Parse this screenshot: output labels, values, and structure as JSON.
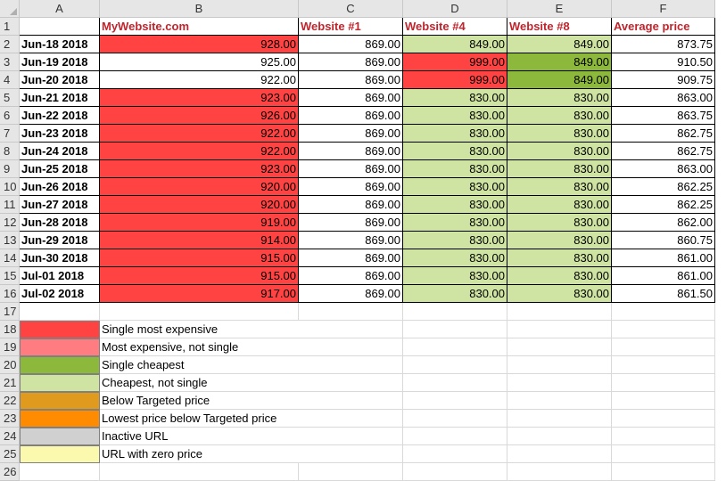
{
  "columns": [
    "A",
    "B",
    "C",
    "D",
    "E",
    "F"
  ],
  "header": [
    "",
    "MyWebsite.com",
    "Website #1",
    "Website #4",
    "Website #8",
    "Average price"
  ],
  "rows": [
    {
      "date": "Jun-18 2018",
      "b": "928.00",
      "c": "869.00",
      "d": "849.00",
      "e": "849.00",
      "f": "873.75"
    },
    {
      "date": "Jun-19 2018",
      "b": "925.00",
      "c": "869.00",
      "d": "999.00",
      "e": "849.00",
      "f": "910.50"
    },
    {
      "date": "Jun-20 2018",
      "b": "922.00",
      "c": "869.00",
      "d": "999.00",
      "e": "849.00",
      "f": "909.75"
    },
    {
      "date": "Jun-21 2018",
      "b": "923.00",
      "c": "869.00",
      "d": "830.00",
      "e": "830.00",
      "f": "863.00"
    },
    {
      "date": "Jun-22 2018",
      "b": "926.00",
      "c": "869.00",
      "d": "830.00",
      "e": "830.00",
      "f": "863.75"
    },
    {
      "date": "Jun-23 2018",
      "b": "922.00",
      "c": "869.00",
      "d": "830.00",
      "e": "830.00",
      "f": "862.75"
    },
    {
      "date": "Jun-24 2018",
      "b": "922.00",
      "c": "869.00",
      "d": "830.00",
      "e": "830.00",
      "f": "862.75"
    },
    {
      "date": "Jun-25 2018",
      "b": "923.00",
      "c": "869.00",
      "d": "830.00",
      "e": "830.00",
      "f": "863.00"
    },
    {
      "date": "Jun-26 2018",
      "b": "920.00",
      "c": "869.00",
      "d": "830.00",
      "e": "830.00",
      "f": "862.25"
    },
    {
      "date": "Jun-27 2018",
      "b": "920.00",
      "c": "869.00",
      "d": "830.00",
      "e": "830.00",
      "f": "862.25"
    },
    {
      "date": "Jun-28 2018",
      "b": "919.00",
      "c": "869.00",
      "d": "830.00",
      "e": "830.00",
      "f": "862.00"
    },
    {
      "date": "Jun-29 2018",
      "b": "914.00",
      "c": "869.00",
      "d": "830.00",
      "e": "830.00",
      "f": "860.75"
    },
    {
      "date": "Jun-30 2018",
      "b": "915.00",
      "c": "869.00",
      "d": "830.00",
      "e": "830.00",
      "f": "861.00"
    },
    {
      "date": "Jul-01 2018",
      "b": "915.00",
      "c": "869.00",
      "d": "830.00",
      "e": "830.00",
      "f": "861.00"
    },
    {
      "date": "Jul-02 2018",
      "b": "917.00",
      "c": "869.00",
      "d": "830.00",
      "e": "830.00",
      "f": "861.50"
    }
  ],
  "fills": {
    "b": [
      "red",
      "white",
      "white",
      "red",
      "red",
      "red",
      "red",
      "red",
      "red",
      "red",
      "red",
      "red",
      "red",
      "red",
      "red"
    ],
    "c": [
      "white",
      "white",
      "white",
      "white",
      "white",
      "white",
      "white",
      "white",
      "white",
      "white",
      "white",
      "white",
      "white",
      "white",
      "white"
    ],
    "d": [
      "lightgreen",
      "red",
      "red",
      "lightgreen",
      "lightgreen",
      "lightgreen",
      "lightgreen",
      "lightgreen",
      "lightgreen",
      "lightgreen",
      "lightgreen",
      "lightgreen",
      "lightgreen",
      "lightgreen",
      "lightgreen"
    ],
    "e": [
      "lightgreen",
      "green",
      "green",
      "lightgreen",
      "lightgreen",
      "lightgreen",
      "lightgreen",
      "lightgreen",
      "lightgreen",
      "lightgreen",
      "lightgreen",
      "lightgreen",
      "lightgreen",
      "lightgreen",
      "lightgreen"
    ],
    "f": [
      "white",
      "white",
      "white",
      "white",
      "white",
      "white",
      "white",
      "white",
      "white",
      "white",
      "white",
      "white",
      "white",
      "white",
      "white"
    ]
  },
  "colors": {
    "red": "#ff4343",
    "pinkred": "#ff7c80",
    "green": "#8cb83b",
    "lightgreen": "#cfe4a3",
    "orange_dark": "#e09a1e",
    "orange": "#ff8c00",
    "gray": "#d0d0d0",
    "yellow": "#fbf9ad",
    "white": "#ffffff",
    "header_text": "#c0242c"
  },
  "legend": [
    {
      "color": "red",
      "label": "Single most expensive"
    },
    {
      "color": "pinkred",
      "label": "Most expensive, not single"
    },
    {
      "color": "green",
      "label": "Single cheapest"
    },
    {
      "color": "lightgreen",
      "label": "Cheapest, not single"
    },
    {
      "color": "orange_dark",
      "label": "Below Targeted price"
    },
    {
      "color": "orange",
      "label": "Lowest price below Targeted price"
    },
    {
      "color": "gray",
      "label": "Inactive URL"
    },
    {
      "color": "yellow",
      "label": "URL with zero price"
    }
  ],
  "row_numbers": [
    "1",
    "2",
    "3",
    "4",
    "5",
    "6",
    "7",
    "8",
    "9",
    "10",
    "11",
    "12",
    "13",
    "14",
    "15",
    "16",
    "17",
    "18",
    "19",
    "20",
    "21",
    "22",
    "23",
    "24",
    "25",
    "26"
  ]
}
